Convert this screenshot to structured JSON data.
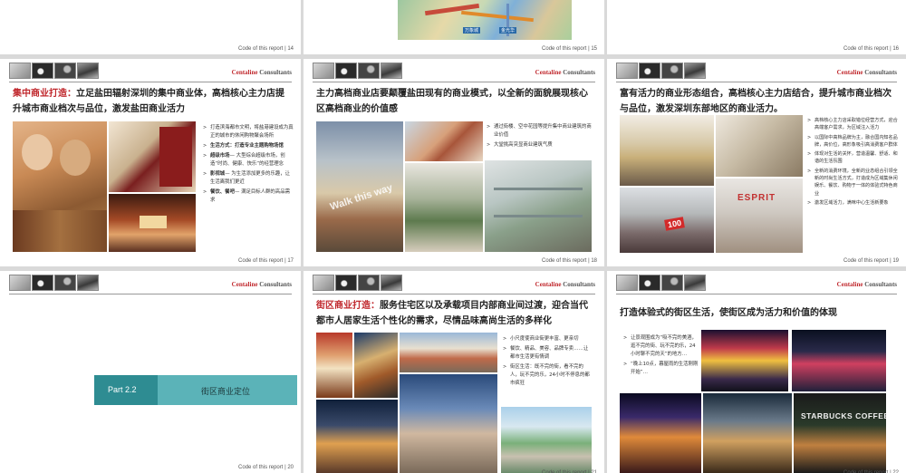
{
  "brand": {
    "name": "Centaline",
    "suffix": "Consultants"
  },
  "footer_prefix": "Code of this report",
  "slides": {
    "s14": {
      "page": "14"
    },
    "s15": {
      "page": "15",
      "map_labels": [
        "万象城",
        "金光华"
      ]
    },
    "s16": {
      "page": "16"
    },
    "s17": {
      "page": "17",
      "title_hl": "集中商业打造：",
      "title_rest": "立足盐田辐射深圳的集中商业体，高档核心主力店提升城市商业档次与品位，激发盐田商业活力",
      "bullets": [
        {
          "lead": "",
          "text": "打造滨海都市文明，将盐港建设成为真正的城市的休闲购物聚会场所"
        },
        {
          "lead": "生活方式：",
          "text": "打造专业主题购物场馆"
        },
        {
          "lead": "超级市场",
          "text": "— 大型综合超级市场，创造“时尚、健康、快乐”的经营理念"
        },
        {
          "lead": "影视城",
          "text": "— 为生活添加更多的乐趣，让生活离我们更近"
        },
        {
          "lead": "餐饮、餐吧",
          "text": "— 满足目标人群的高品需求"
        }
      ]
    },
    "s18": {
      "page": "18",
      "title": "主力高档商业店要颠覆盐田现有的商业模式，以全新的面貌展现核心区高档商业的价值感",
      "photo_text": "Walk this way",
      "bullets": [
        {
          "text": "通过街楼、空中花园等提升集中商业建筑的商业价值"
        },
        {
          "text": "大堂挑高突显商业建筑气质"
        }
      ]
    },
    "s19": {
      "page": "19",
      "title": "富有活力的商业形态组合，高档核心主力店结合，提升城市商业档次与品位，激发深圳东部地区的商业活力。",
      "signs": [
        "100",
        "ESPRIT"
      ],
      "bullets": [
        {
          "text": "高档核心主力店采取错位经营方式，迎合高端客户需求，为区域注入活力"
        },
        {
          "text": "以国际中高档品牌为主，融合国内知名品牌，高价位，高形象吸引高消费客户群体"
        },
        {
          "text": "体现对生活的关怀，营造温馨、舒适、和谐的生活氛围"
        },
        {
          "text": "全新的消费环境，全新的业态组合引领全新的时尚生活方式，打造成为区域集休闲娱乐、餐饮、购物于一体的体验式特色商业"
        },
        {
          "text": "激发区域活力，满咪中心生活新要象"
        }
      ]
    },
    "s20": {
      "page": "20",
      "part_label": "Part 2.2",
      "part_title": "街区商业定位"
    },
    "s21": {
      "page": "21",
      "title_hl": "街区商业打造：",
      "title_rest": "服务住宅区以及承载项目内部商业间过渡，迎合当代都市人居家生活个性化的需求，尽情品味高尚生活的多样化",
      "bullets": [
        {
          "text": "小尺度使商业街更丰富、更亲切"
        },
        {
          "text": "餐饮、精品、美容、品牌专卖……让都市生活更有情调"
        },
        {
          "text": "街区生活：既不完的街，看不完的人，玩不完的乐，24小时不停息的都市疯狂"
        }
      ]
    },
    "s22": {
      "page": "22",
      "title": "打造体验式的街区生活，使街区成为活力和价值的体现",
      "bullets": [
        {
          "text": "让景观围成为“吸不完的美酒，逛不完的街、玩不完的乐，24小时聊不完的天”的地方…"
        },
        {
          "text": "“晚上10点，暮屋雨的生活刚刚开始”…"
        }
      ],
      "sign": "STARBUCKS COFFEE"
    }
  }
}
